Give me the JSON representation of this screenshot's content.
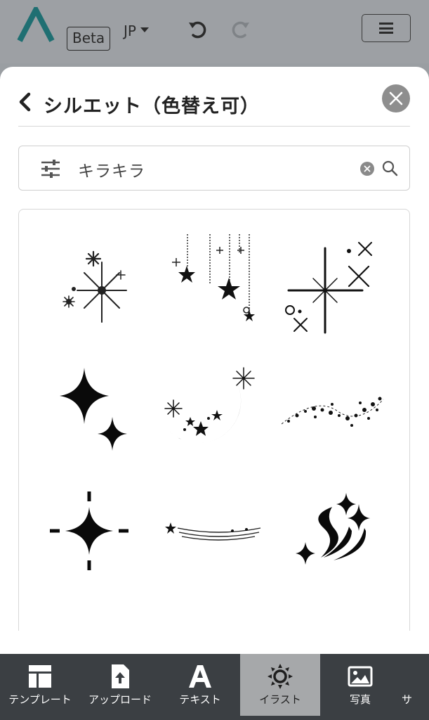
{
  "header": {
    "beta_label": "Beta",
    "language": "JP",
    "logo_icon": "app-logo",
    "undo_icon": "undo-icon",
    "redo_icon": "redo-icon",
    "menu_icon": "hamburger-menu-icon"
  },
  "panel": {
    "title": "シルエット（色替え可）",
    "back_icon": "chevron-left-icon",
    "close_icon": "close-icon"
  },
  "search": {
    "value": "キラキラ",
    "filter_icon": "filter-sliders-icon",
    "clear_icon": "clear-icon",
    "search_icon": "search-icon"
  },
  "results": [
    {
      "name": "sparkle-burst-illustration"
    },
    {
      "name": "moon-and-hanging-stars-illustration"
    },
    {
      "name": "cross-star-glints-illustration"
    },
    {
      "name": "two-four-point-stars-illustration"
    },
    {
      "name": "crescent-moon-with-stars-illustration"
    },
    {
      "name": "star-trail-wave-illustration"
    },
    {
      "name": "dashed-four-point-star-illustration"
    },
    {
      "name": "shooting-star-lines-illustration"
    },
    {
      "name": "swoosh-with-stars-illustration"
    }
  ],
  "bottom_nav": [
    {
      "label": "テンプレート",
      "icon": "template-icon",
      "active": false
    },
    {
      "label": "アップロード",
      "icon": "upload-file-icon",
      "active": false
    },
    {
      "label": "テキスト",
      "icon": "text-a-icon",
      "active": false
    },
    {
      "label": "イラスト",
      "icon": "sun-icon",
      "active": true
    },
    {
      "label": "写真",
      "icon": "image-icon",
      "active": false
    },
    {
      "label": "サ",
      "icon": "",
      "active": false
    }
  ],
  "colors": {
    "overlay": "#9a9ea2",
    "logo_teal": "#1f6f72",
    "nav_bg": "#3b3f43",
    "nav_active": "#a6a8aa"
  }
}
